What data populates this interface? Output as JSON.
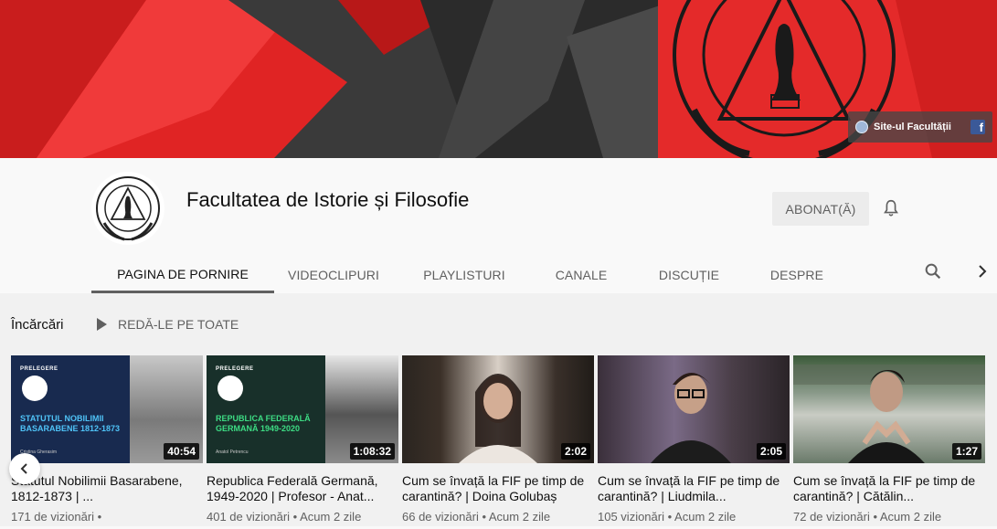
{
  "banner": {
    "links_label": "Site-ul Facultății",
    "facebook_glyph": "f",
    "colors": {
      "red": "#e02424",
      "dark": "#2e2e2e"
    }
  },
  "channel": {
    "name": "Facultatea de Istorie și Filosofie",
    "subscribe_label": "ABONAT(Ă)"
  },
  "tabs": [
    {
      "label": "PAGINA DE PORNIRE",
      "active": true
    },
    {
      "label": "VIDEOCLIPURI",
      "active": false
    },
    {
      "label": "PLAYLISTURI",
      "active": false
    },
    {
      "label": "CANALE",
      "active": false
    },
    {
      "label": "DISCUȚIE",
      "active": false
    },
    {
      "label": "DESPRE",
      "active": false
    }
  ],
  "shelf": {
    "title": "Încărcări",
    "play_all_label": "REDĂ-LE PE TOATE"
  },
  "videos": [
    {
      "title": "Statutul Nobilimii Basarabene, 1812-1873 | ...",
      "meta": "171 de vizionări •",
      "duration": "40:54",
      "thumb": {
        "label": "PRELEGERE",
        "headline": "STATUTUL NOBILIMII BASARABENE 1812-1873",
        "author": "Cristina Gherasim",
        "accent": "#4fc3f7"
      }
    },
    {
      "title": "Republica Federală Germană, 1949-2020 | Profesor - Anat...",
      "meta": "401 de vizionări • Acum 2 zile",
      "duration": "1:08:32",
      "thumb": {
        "label": "PRELEGERE",
        "headline": "REPUBLICA FEDERALĂ GERMANĂ 1949-2020",
        "author": "Anatol Petrencu",
        "accent": "#3ddc84"
      }
    },
    {
      "title": "Cum se învață la FIF pe timp de carantină? | Doina Golubaș",
      "meta": "66 de vizionări • Acum 2 zile",
      "duration": "2:02"
    },
    {
      "title": "Cum se învață la FIF pe timp de carantină? | Liudmila...",
      "meta": "105 vizionări • Acum 2 zile",
      "duration": "2:05"
    },
    {
      "title": "Cum se învață la FIF pe timp de carantină? | Cătălin...",
      "meta": "72 de vizionări • Acum 2 zile",
      "duration": "1:27"
    }
  ],
  "icons": [
    "globe-icon",
    "facebook-icon",
    "bell-icon",
    "search-icon",
    "chevron-right-icon",
    "play-icon",
    "chevron-left-icon"
  ]
}
